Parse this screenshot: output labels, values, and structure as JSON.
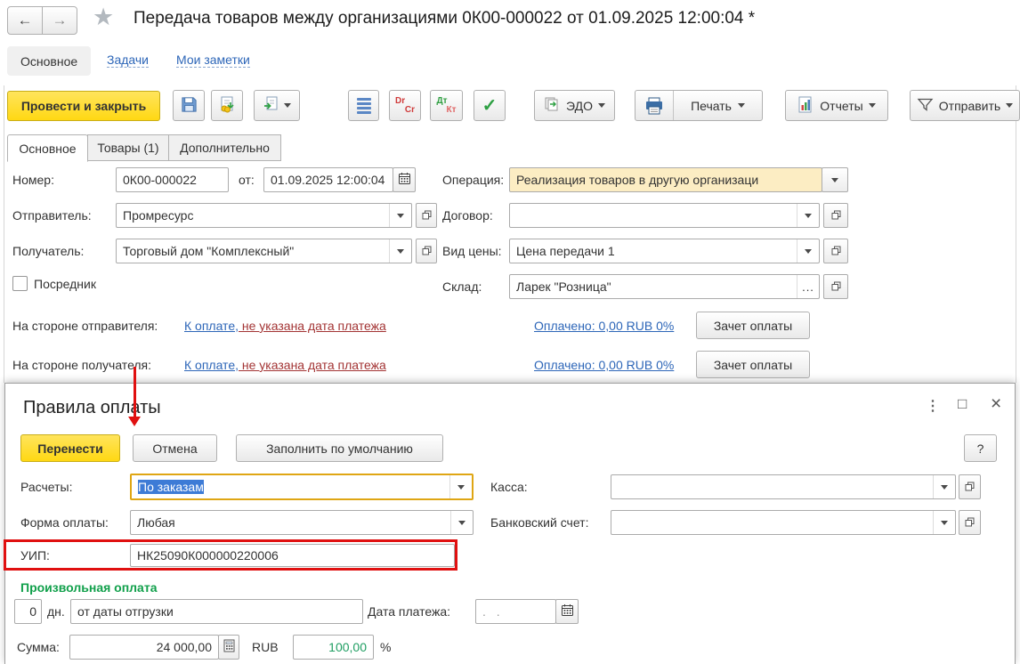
{
  "header": {
    "back_icon": "←",
    "forward_icon": "→",
    "star_icon": "★",
    "title": "Передача товаров между организациями 0К00-000022 от 01.09.2025 12:00:04 *",
    "nav": {
      "main": "Основное",
      "tasks": "Задачи",
      "notes": "Мои заметки"
    }
  },
  "toolbar": {
    "post_close": "Провести и закрыть",
    "dr": "Dr",
    "cr": "Cr",
    "dt": "Дт",
    "kt": "Кт",
    "check_icon": "✓",
    "edo": "ЭДО",
    "print": "Печать",
    "reports": "Отчеты",
    "send": "Отправить"
  },
  "tabs": {
    "main": "Основное",
    "goods": "Товары (1)",
    "extra": "Дополнительно"
  },
  "form": {
    "number_label": "Номер:",
    "number": "0К00-000022",
    "date_label": "от:",
    "date": "01.09.2025 12:00:04",
    "operation_label": "Операция:",
    "operation": "Реализация товаров в другую организаци",
    "sender_label": "Отправитель:",
    "sender": "Промресурс",
    "contract_label": "Договор:",
    "contract": "",
    "receiver_label": "Получатель:",
    "receiver": "Торговый дом \"Комплексный\"",
    "price_label": "Вид цены:",
    "price": "Цена передачи 1",
    "intermediary_label": "Посредник",
    "warehouse_label": "Склад:",
    "warehouse": "Ларек \"Розница\"",
    "warehouse_more": "...",
    "sender_side_label": "На стороне отправителя:",
    "receiver_side_label": "На стороне получателя:",
    "pay_link_blue": "К оплате,",
    "pay_link_red": " не указана дата платежа",
    "paid_link": "Оплачено: 0,00 RUB 0%",
    "offset_button": "Зачет оплаты"
  },
  "dialog": {
    "title": "Правила оплаты",
    "controls": {
      "menu": "⋮",
      "maximize": "□",
      "close": "×"
    },
    "transfer_button": "Перенести",
    "cancel_button": "Отмена",
    "fill_default_button": "Заполнить по умолчанию",
    "help_button": "?",
    "calc_label": "Расчеты:",
    "calc_value": "По заказам",
    "cash_label": "Касса:",
    "cash_value": "",
    "payform_label": "Форма оплаты:",
    "payform_value": "Любая",
    "bank_label": "Банковский счет:",
    "bank_value": "",
    "uip_label": "УИП:",
    "uip_value": "НК25090К000000220006",
    "custom_section": "Произвольная оплата",
    "days": "0",
    "days_unit": "дн.",
    "from_event": "от даты отгрузки",
    "paydate_label": "Дата платежа:",
    "paydate_value": ". .",
    "amount_label": "Сумма:",
    "amount": "24 000,00",
    "currency": "RUB",
    "percent": "100,00",
    "percent_sign": "%"
  },
  "colors": {
    "accent_yellow": "#ffd813",
    "link_blue": "#2d66b8",
    "alert_red": "#a33434",
    "annotation_red": "#e01010",
    "section_green": "#11a04b",
    "selection_blue": "#3d7bd6",
    "operation_bg": "#fcedc3"
  }
}
